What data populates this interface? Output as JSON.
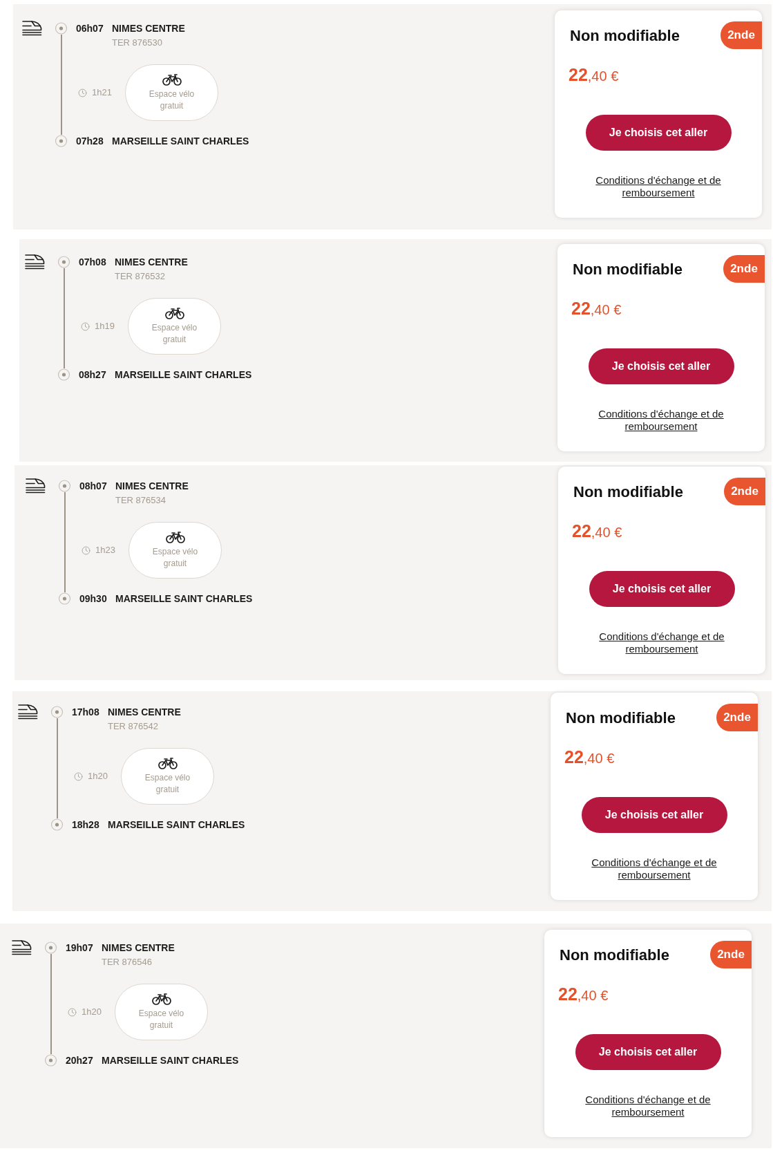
{
  "trips": [
    {
      "departure": {
        "time": "06h07",
        "station": "NIMES CENTRE"
      },
      "train": "TER 876530",
      "duration": "1h21",
      "service": "Espace vélo gratuit",
      "arrival": {
        "time": "07h28",
        "station": "MARSEILLE SAINT CHARLES"
      },
      "offer": {
        "title": "Non modifiable",
        "class": "2nde",
        "price": "**22**,40 €",
        "button": "Je choisis cet aller",
        "link": "Conditions d'échange et de remboursement"
      }
    },
    {
      "departure": {
        "time": "07h08",
        "station": "NIMES CENTRE"
      },
      "train": "TER 876532",
      "duration": "1h19",
      "service": "Espace vélo gratuit",
      "arrival": {
        "time": "08h27",
        "station": "MARSEILLE SAINT CHARLES"
      },
      "offer": {
        "title": "Non modifiable",
        "class": "2nde",
        "price": "**22**,40 €",
        "button": "Je choisis cet aller",
        "link": "Conditions d'échange et de remboursement"
      }
    },
    {
      "departure": {
        "time": "08h07",
        "station": "NIMES CENTRE"
      },
      "train": "TER 876534",
      "duration": "1h23",
      "service": "Espace vélo gratuit",
      "arrival": {
        "time": "09h30",
        "station": "MARSEILLE SAINT CHARLES"
      },
      "offer": {
        "title": "Non modifiable",
        "class": "2nde",
        "price": "**22**,40 €",
        "button": "Je choisis cet aller",
        "link": "Conditions d'échange et de remboursement"
      }
    },
    {
      "departure": {
        "time": "17h08",
        "station": "NIMES CENTRE"
      },
      "train": "TER 876542",
      "duration": "1h20",
      "service": "Espace vélo gratuit",
      "arrival": {
        "time": "18h28",
        "station": "MARSEILLE SAINT CHARLES"
      },
      "offer": {
        "title": "Non modifiable",
        "class": "2nde",
        "price": "**22**,40 €",
        "button": "Je choisis cet aller",
        "link": "Conditions d'échange et de remboursement"
      }
    },
    {
      "departure": {
        "time": "19h07",
        "station": "NIMES CENTRE"
      },
      "train": "TER 876546",
      "duration": "1h20",
      "service": "Espace vélo gratuit",
      "arrival": {
        "time": "20h27",
        "station": "MARSEILLE SAINT CHARLES"
      },
      "offer": {
        "title": "Non modifiable",
        "class": "2nde",
        "price": "**22**,40 €",
        "button": "Je choisis cet aller",
        "link": "Conditions d'échange et de remboursement"
      }
    }
  ]
}
